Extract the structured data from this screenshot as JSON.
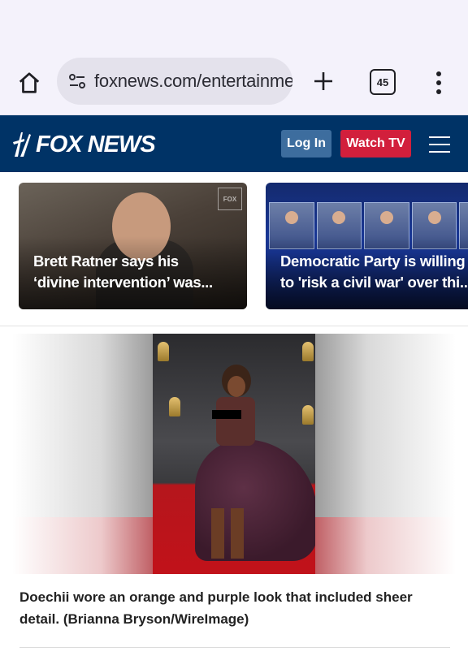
{
  "browser": {
    "url": "foxnews.com/entertainme",
    "tab_count": "45",
    "icons": {
      "home": "home-icon",
      "site_settings": "site-settings-icon",
      "new_tab": "plus-icon",
      "tabs": "tab-switcher-icon",
      "menu": "more-vert-icon"
    }
  },
  "header": {
    "logo_text": "FOX NEWS",
    "login_label": "Log In",
    "watch_label": "Watch TV",
    "colors": {
      "bar": "#003366",
      "login": "#3d6d9e",
      "watch": "#d21f3c"
    }
  },
  "stories": [
    {
      "line1": "Brett Ratner says his",
      "line2": "‘divine intervention’ was..."
    },
    {
      "line1": "Democratic Party is willing",
      "line2": "to 'risk a civil war' over thi..."
    }
  ],
  "article": {
    "caption": "Doechii wore an orange and purple look that included sheer detail. (Brianna Bryson/WireImage)"
  }
}
